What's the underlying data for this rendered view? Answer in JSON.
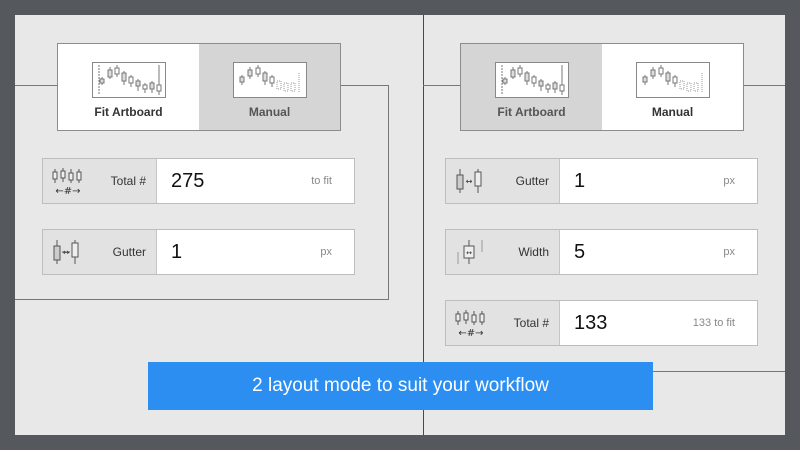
{
  "left_panel": {
    "modes": [
      {
        "label": "Fit Artboard",
        "preview_icon": "candlestick-fit-artboard-icon",
        "selected": true
      },
      {
        "label": "Manual",
        "preview_icon": "candlestick-manual-icon",
        "selected": false
      }
    ],
    "fields": [
      {
        "label": "Total #",
        "value": "275",
        "unit": "to fit",
        "icon": "total-count-icon"
      },
      {
        "label": "Gutter",
        "value": "1",
        "unit": "px",
        "icon": "gutter-icon"
      }
    ]
  },
  "right_panel": {
    "modes": [
      {
        "label": "Fit Artboard",
        "preview_icon": "candlestick-fit-artboard-icon",
        "selected": false
      },
      {
        "label": "Manual",
        "preview_icon": "candlestick-manual-icon",
        "selected": true
      }
    ],
    "fields": [
      {
        "label": "Gutter",
        "value": "1",
        "unit": "px",
        "icon": "gutter-icon"
      },
      {
        "label": "Width",
        "value": "5",
        "unit": "px",
        "icon": "width-icon"
      },
      {
        "label": "Total #",
        "value": "133",
        "unit": "133 to fit",
        "icon": "total-count-icon"
      }
    ]
  },
  "banner": {
    "text": "2 layout mode to suit your workflow"
  },
  "colors": {
    "banner": "#2b8ef0",
    "canvas": "#e8e8e8",
    "frame": "#55585c",
    "selected_dim": "#d5d5d5"
  }
}
